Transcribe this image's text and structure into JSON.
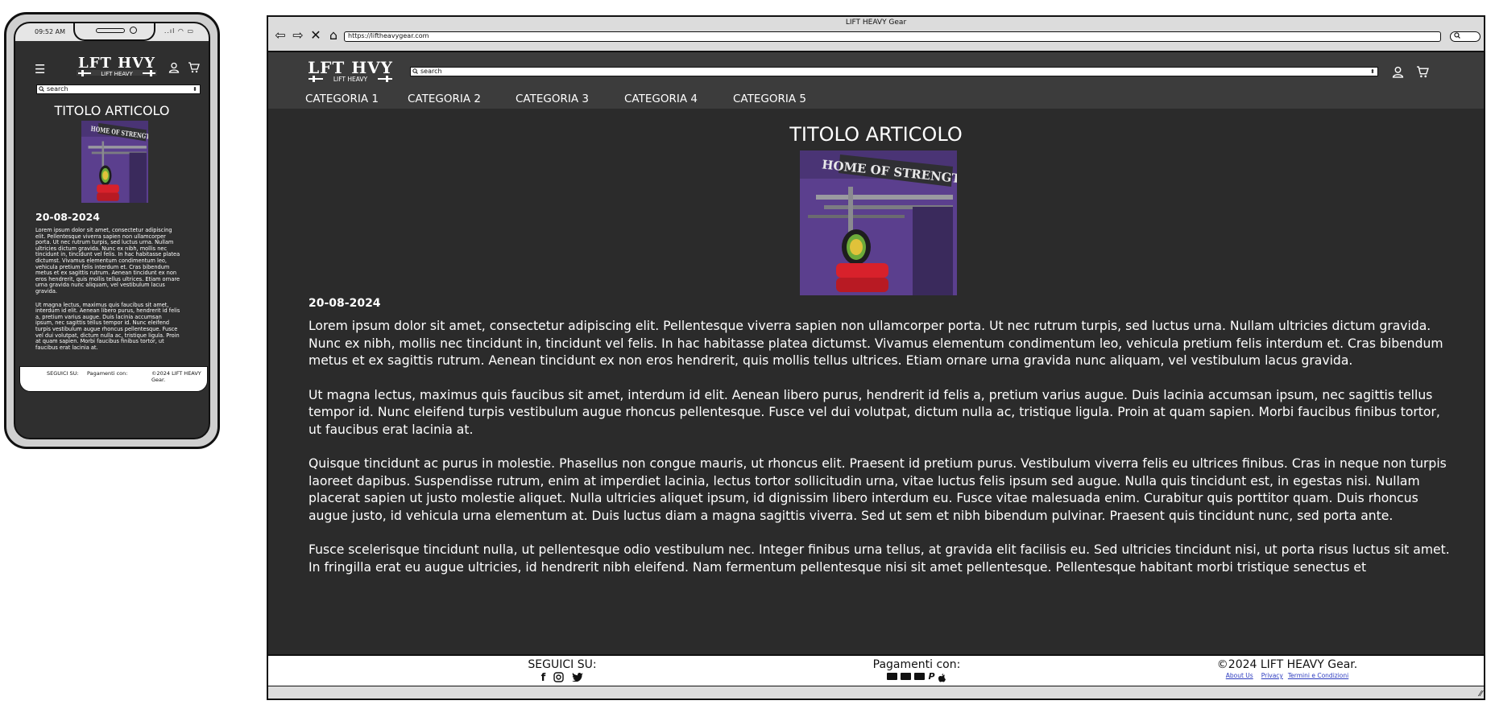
{
  "mobile": {
    "status_time": "09:52 AM",
    "status_icons": "..ıl ◠ ▭",
    "logo_top": "LFT HVY",
    "logo_bottom": "LIFT HEAVY",
    "search_placeholder": "search",
    "article_title": "TITOLO ARTICOLO",
    "image_caption": "HOME OF STRENGTH",
    "date": "20-08-2024",
    "paragraphs": [
      "Lorem ipsum dolor sit amet, consectetur adipiscing elit. Pellentesque viverra sapien non ullamcorper porta. Ut nec rutrum turpis, sed luctus urna. Nullam ultricies dictum gravida. Nunc ex nibh, mollis nec tincidunt in, tincidunt vel felis. In hac habitasse platea dictumst. Vivamus elementum condimentum leo, vehicula pretium felis interdum et. Cras bibendum metus et ex sagittis rutrum. Aenean tincidunt ex non eros hendrerit, quis mollis tellus ultrices. Etiam ornare urna gravida nunc aliquam, vel vestibulum lacus gravida.",
      "Ut magna lectus, maximus quis faucibus sit amet, interdum id elit. Aenean libero purus, hendrerit id felis a, pretium varius augue. Duis lacinia accumsan ipsum, nec sagittis tellus tempor id. Nunc eleifend turpis vestibulum augue rhoncus pellentesque. Fusce vel dui volutpat, dictum nulla ac, tristique ligula. Proin at quam sapien. Morbi faucibus finibus tortor, ut faucibus erat lacinia at."
    ],
    "footer": {
      "follow": "SEGUICI SU:",
      "payments": "Pagamenti con:",
      "copyright": "©2024 LIFT HEAVY Gear."
    }
  },
  "desktop": {
    "window_title": "LIFT HEAVY Gear",
    "url": "https://liftheavygear.com",
    "logo_top": "LFT HVY",
    "logo_bottom": "LIFT HEAVY",
    "search_placeholder": "search",
    "categories": [
      "CATEGORIA 1",
      "CATEGORIA 2",
      "CATEGORIA 3",
      "CATEGORIA 4",
      "CATEGORIA 5"
    ],
    "article_title": "TITOLO ARTICOLO",
    "image_caption": "HOME OF STRENGTH",
    "date": "20-08-2024",
    "paragraphs": [
      "Lorem ipsum dolor sit amet, consectetur adipiscing elit. Pellentesque viverra sapien non ullamcorper porta. Ut nec rutrum turpis, sed luctus urna. Nullam ultricies dictum gravida. Nunc ex nibh, mollis nec tincidunt in, tincidunt vel felis. In hac habitasse platea dictumst. Vivamus elementum condimentum leo, vehicula pretium felis interdum et. Cras bibendum metus et ex sagittis rutrum. Aenean tincidunt ex non eros hendrerit, quis mollis tellus ultrices. Etiam ornare urna gravida nunc aliquam, vel vestibulum lacus gravida.",
      "Ut magna lectus, maximus quis faucibus sit amet, interdum id elit. Aenean libero purus, hendrerit id felis a, pretium varius augue. Duis lacinia accumsan ipsum, nec sagittis tellus tempor id. Nunc eleifend turpis vestibulum augue rhoncus pellentesque. Fusce vel dui volutpat, dictum nulla ac, tristique ligula. Proin at quam sapien. Morbi faucibus finibus tortor, ut faucibus erat lacinia at.",
      "Quisque tincidunt ac purus in molestie. Phasellus non congue mauris, ut rhoncus elit. Praesent id pretium purus. Vestibulum viverra felis eu ultrices finibus. Cras in neque non turpis laoreet dapibus. Suspendisse rutrum, enim at imperdiet lacinia, lectus tortor sollicitudin urna, vitae luctus felis ipsum sed augue. Nulla quis tincidunt est, in egestas nisi. Nullam placerat sapien ut justo molestie aliquet. Nulla ultricies aliquet ipsum, id dignissim libero interdum eu. Fusce vitae malesuada enim. Curabitur quis porttitor quam. Duis rhoncus augue justo, id vehicula urna elementum at. Duis luctus diam a magna sagittis viverra. Sed ut sem et nibh bibendum pulvinar. Praesent quis tincidunt nunc, sed porta ante.",
      "Fusce scelerisque tincidunt nulla, ut pellentesque odio vestibulum nec. Integer finibus urna tellus, at gravida elit facilisis eu. Sed ultricies tincidunt nisi, ut porta risus luctus sit amet. In fringilla erat eu augue ultricies, id hendrerit nibh eleifend. Nam fermentum pellentesque nisi sit amet pellentesque. Pellentesque habitant morbi tristique senectus et"
    ],
    "footer": {
      "follow": "SEGUICI SU:",
      "payments": "Pagamenti con:",
      "copyright": "©2024 LIFT HEAVY Gear.",
      "links": [
        "About Us",
        "Privacy",
        "Termini e Condizioni"
      ]
    }
  },
  "colors": {
    "page_bg": "#2b2b2b",
    "header_bg": "#3c3c3c",
    "link": "#2c3bbf"
  }
}
